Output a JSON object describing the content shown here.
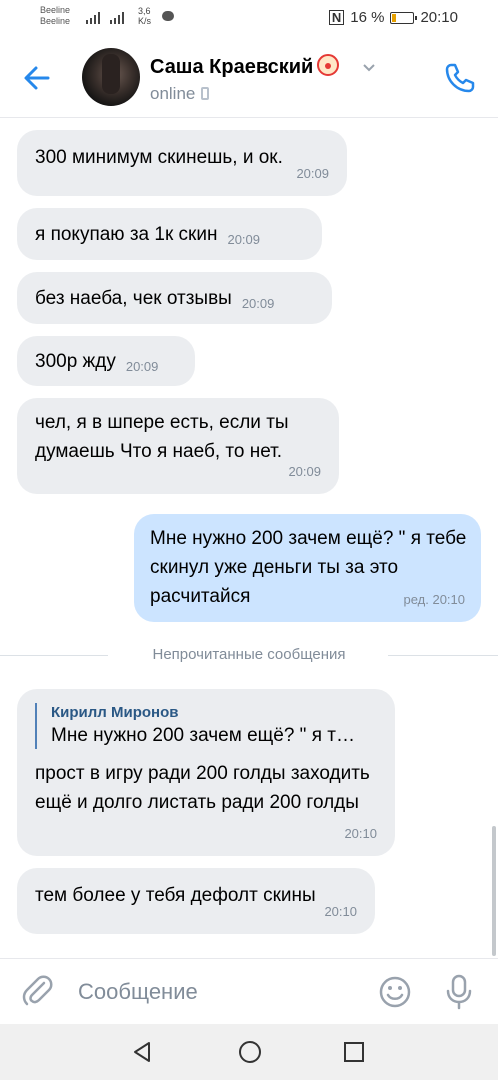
{
  "status_bar": {
    "carrier1": "Beeline",
    "carrier2": "Beeline",
    "speed_value": "3,6",
    "speed_unit": "K/s",
    "battery": "16 %",
    "time": "20:10"
  },
  "header": {
    "contact_name": "Саша Краевский",
    "status": "online"
  },
  "messages": [
    {
      "text": "300 минимум скинешь, и ок.",
      "time": "20:09"
    },
    {
      "text": "я покупаю за 1к скин",
      "time": "20:09"
    },
    {
      "text": "без наеба, чек отзывы",
      "time": "20:09"
    },
    {
      "text": "300р жду",
      "time": "20:09"
    },
    {
      "text": "чел, я в шпере есть, если ты думаешь Что я наеб, то нет.",
      "time": "20:09"
    },
    {
      "text": "Мне нужно 200 зачем ещё? \" я тебе скинул уже деньги ты за это расчитайся",
      "time": "ред. 20:10"
    },
    {
      "reply_author": "Кирилл Миронов",
      "reply_text": "Мне нужно 200 зачем ещё? \" я т…",
      "text": "прост в игру ради 200 голды заходить ещё и долго листать ради 200 голды",
      "time": "20:10"
    },
    {
      "text": "тем более у тебя дефолт скины",
      "time": "20:10"
    }
  ],
  "divider": "Непрочитанные сообщения",
  "input": {
    "placeholder": "Сообщение"
  },
  "colors": {
    "accent": "#2688eb",
    "incoming_bubble": "#ebedf0",
    "outgoing_bubble": "#cce4ff"
  }
}
